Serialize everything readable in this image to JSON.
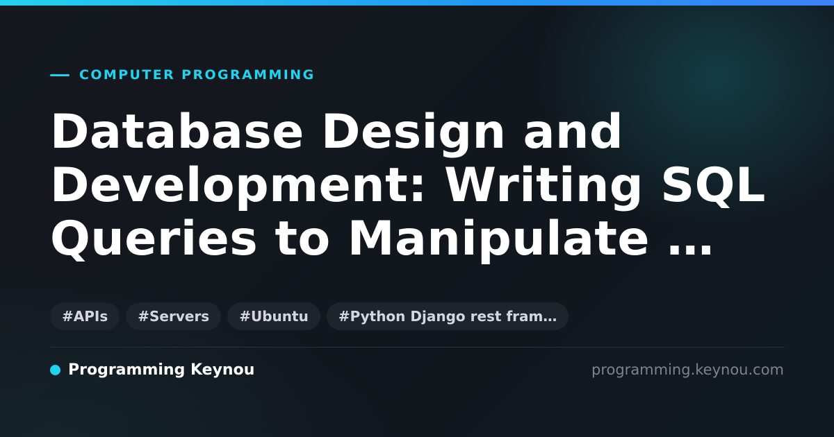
{
  "category": "COMPUTER PROGRAMMING",
  "title": "Database Design and Development: Writing SQL Queries to Manipulate …",
  "tags": [
    "#APIs",
    "#Servers",
    "#Ubuntu",
    "#Python Django rest fram…"
  ],
  "brand": {
    "name": "Programming Keynou",
    "url": "programming.keynou.com"
  },
  "colors": {
    "accent": "#22d3ee",
    "background": "#12161d",
    "tag_background": "#1f242c",
    "muted_text": "#7c838d"
  }
}
